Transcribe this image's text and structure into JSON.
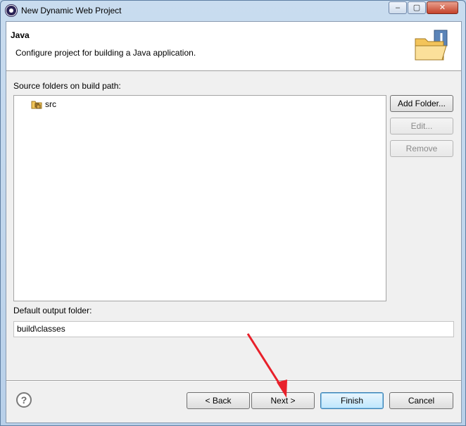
{
  "window": {
    "title": "New Dynamic Web Project",
    "controls": {
      "minimize": "–",
      "maximize": "▢",
      "close": "✕"
    }
  },
  "header": {
    "title": "Java",
    "description": "Configure project for building a Java application.",
    "icon": "java-folder-icon"
  },
  "source": {
    "label": "Source folders on build path:",
    "items": [
      {
        "label": "src",
        "icon": "source-package-icon"
      }
    ],
    "buttons": {
      "add": "Add Folder...",
      "edit": "Edit...",
      "remove": "Remove"
    }
  },
  "output": {
    "label": "Default output folder:",
    "value": "build\\classes"
  },
  "footer": {
    "help": "?",
    "back": "< Back",
    "next": "Next >",
    "finish": "Finish",
    "cancel": "Cancel"
  },
  "colors": {
    "annotation_arrow": "#e8202a"
  }
}
